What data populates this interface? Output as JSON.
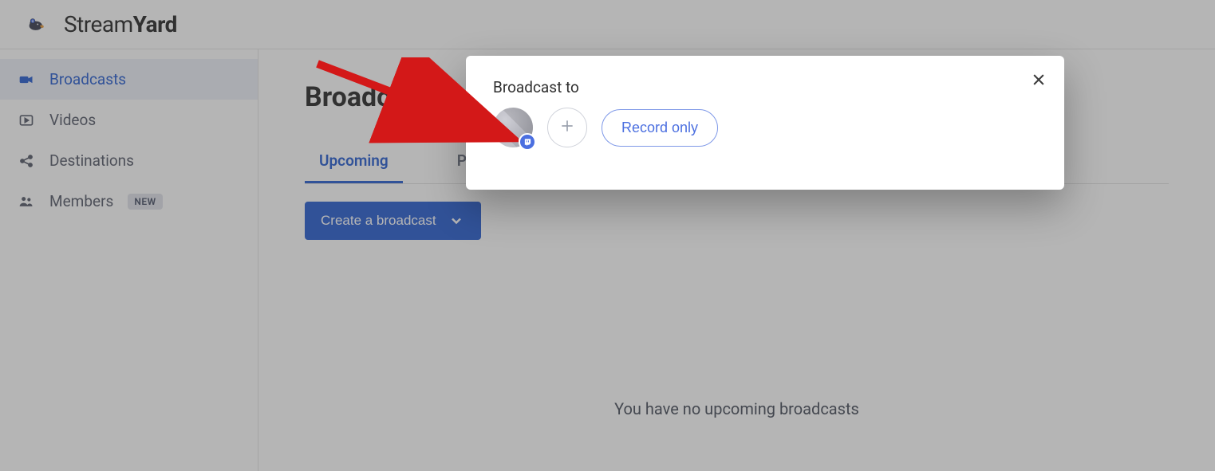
{
  "brand": {
    "light": "Stream",
    "bold": "Yard"
  },
  "sidebar": {
    "items": [
      {
        "label": "Broadcasts",
        "icon": "camera-icon",
        "active": true
      },
      {
        "label": "Videos",
        "icon": "video-icon"
      },
      {
        "label": "Destinations",
        "icon": "share-icon"
      },
      {
        "label": "Members",
        "icon": "members-icon",
        "badge": "NEW"
      }
    ]
  },
  "main": {
    "title": "Broadcasts",
    "tabs": [
      {
        "label": "Upcoming",
        "active": true
      },
      {
        "label": "Past"
      }
    ],
    "create_label": "Create a broadcast",
    "empty_text": "You have no upcoming broadcasts"
  },
  "modal": {
    "title": "Broadcast to",
    "record_only_label": "Record only",
    "destination_platform": "twitch"
  }
}
